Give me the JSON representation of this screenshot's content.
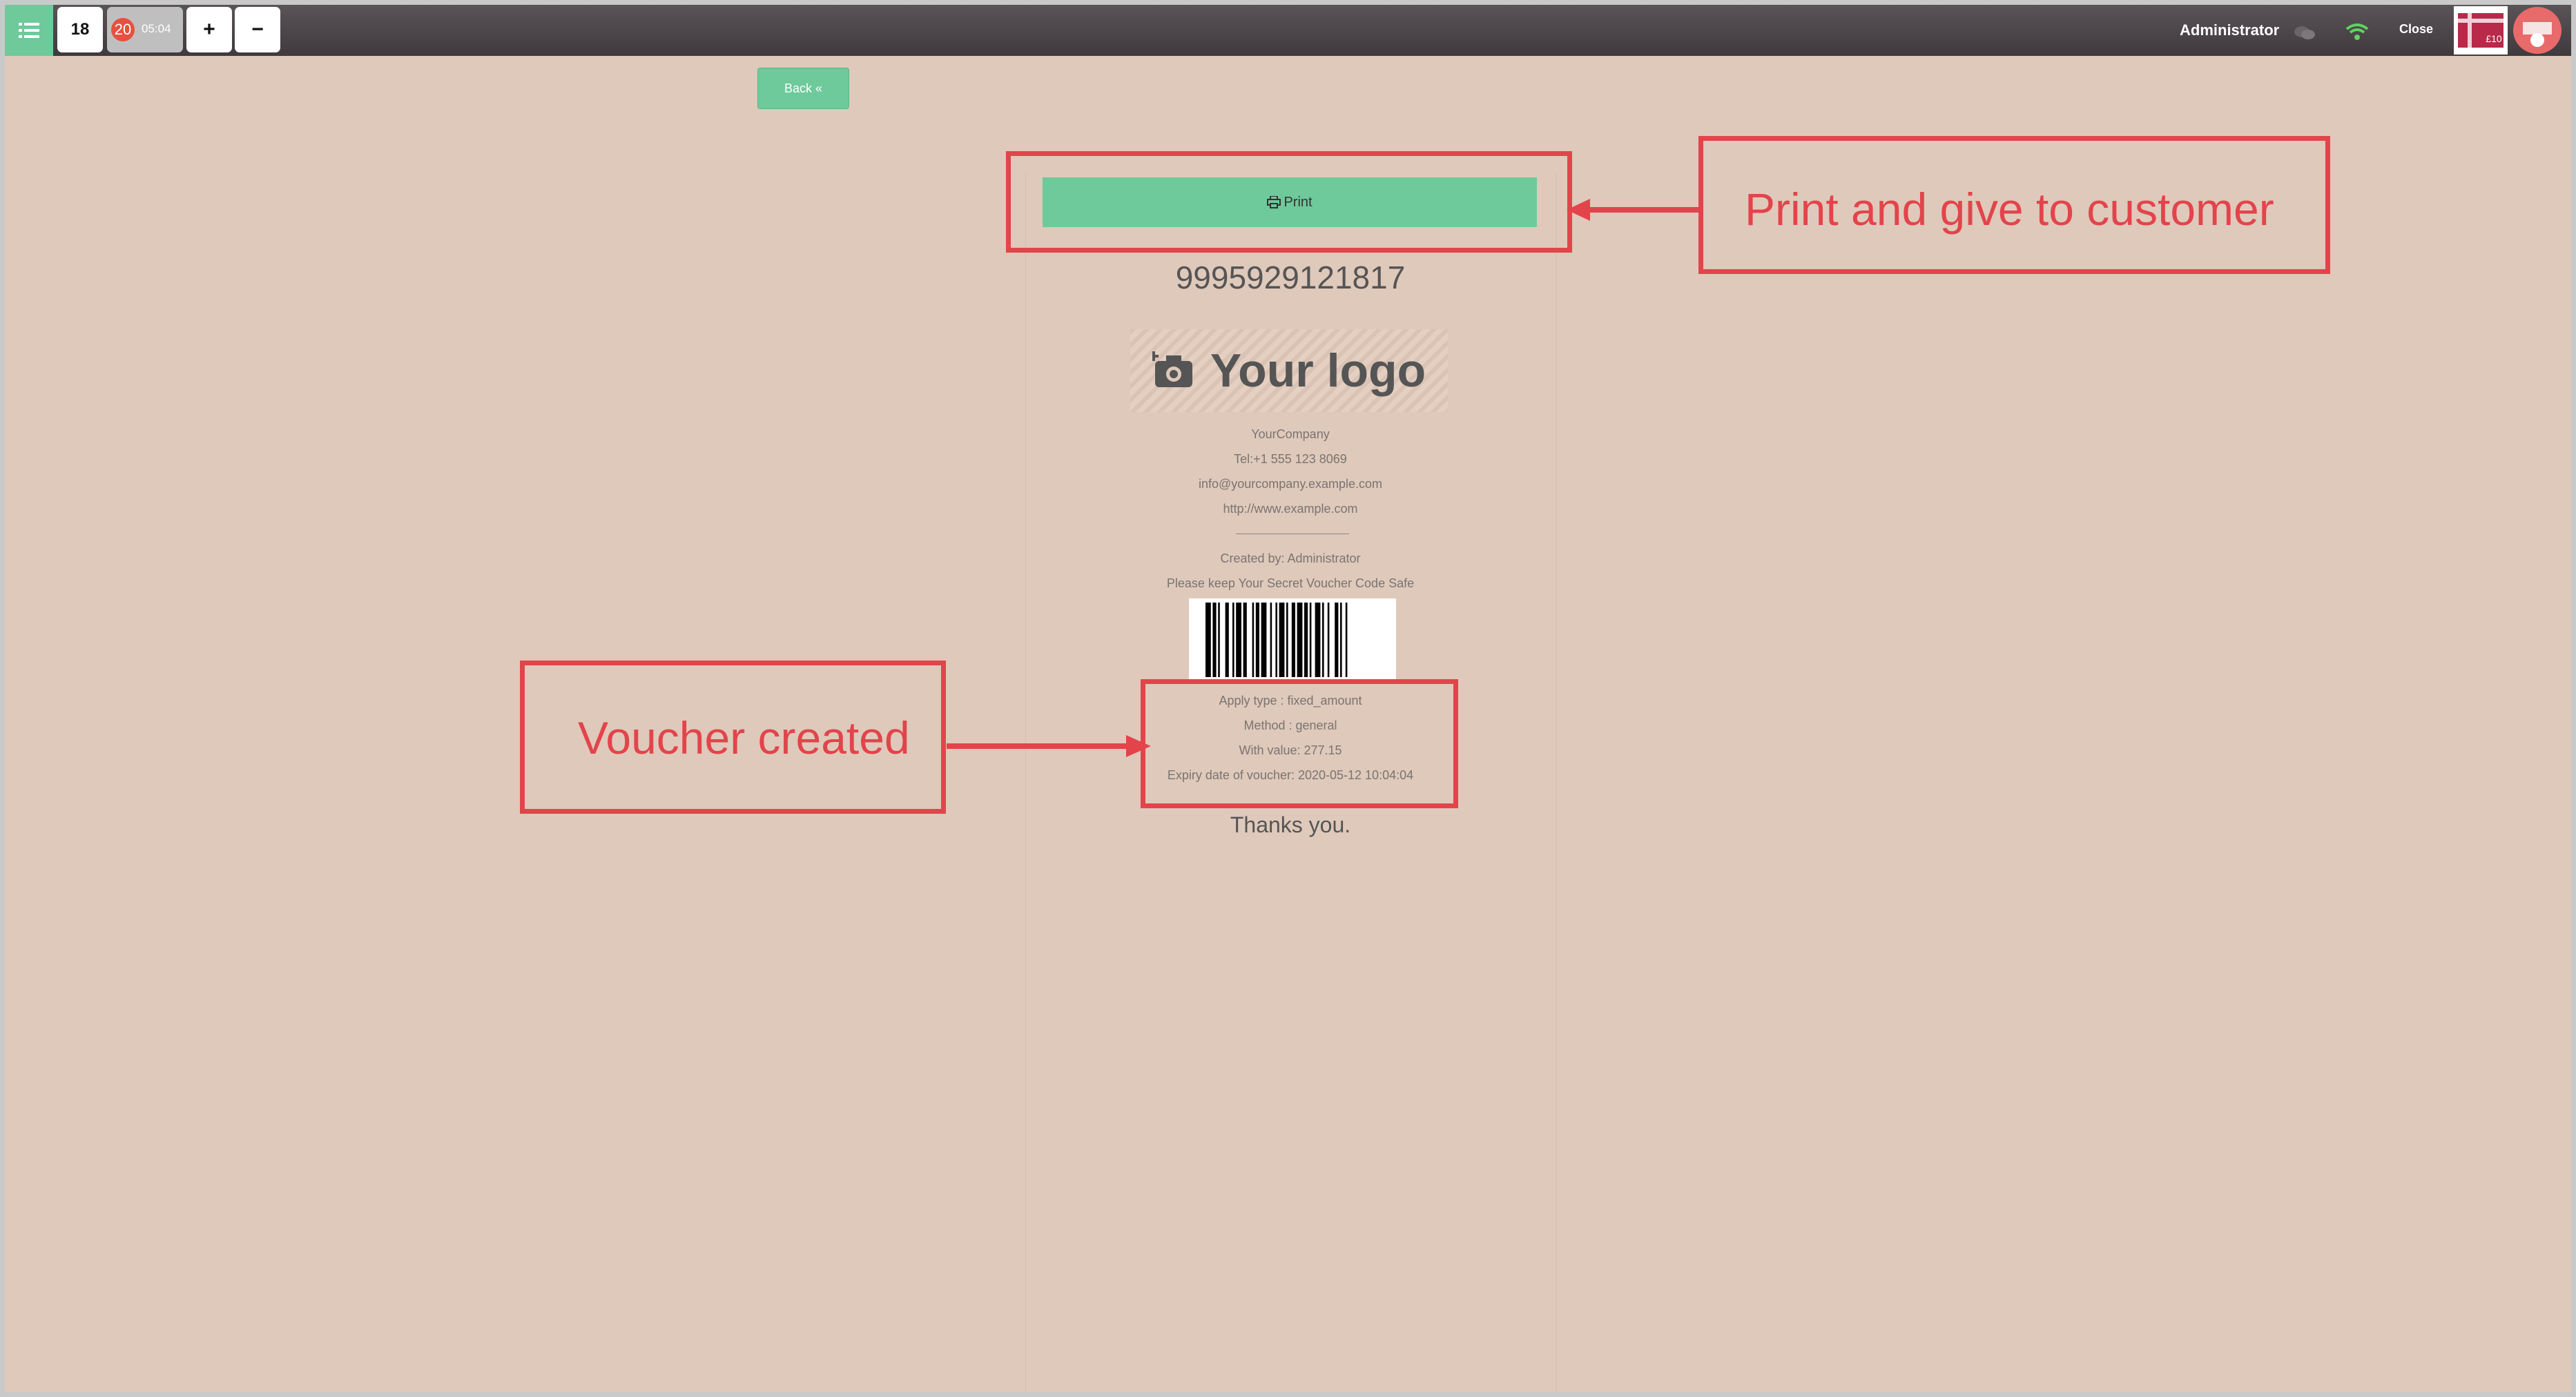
{
  "topbar": {
    "table_number": "18",
    "order_count": "20",
    "order_time": "05:04",
    "plus_label": "+",
    "minus_label": "−",
    "user": "Administrator",
    "close_label": "Close",
    "gift_card_label": "£10"
  },
  "back_label": "Back «",
  "print_label": "Print",
  "receipt": {
    "voucher_code": "9995929121817",
    "logo_text": "Your logo",
    "company": "YourCompany",
    "phone": "Tel:+1 555 123 8069",
    "email": "info@yourcompany.example.com",
    "website": "http://www.example.com",
    "created_by": "Created by: Administrator",
    "safety_note": "Please keep Your Secret Voucher Code Safe",
    "apply_type": "Apply type : fixed_amount",
    "method": "Method : general",
    "value": "With value: 277.15",
    "expiry": "Expiry date of voucher: 2020-05-12 10:04:04",
    "thanks": "Thanks you."
  },
  "annotations": {
    "print_note": "Print and give to customer",
    "voucher_note": "Voucher created"
  },
  "colors": {
    "accent": "#6ec99b",
    "annotation": "#e3444b",
    "background": "#dfc9bb"
  }
}
